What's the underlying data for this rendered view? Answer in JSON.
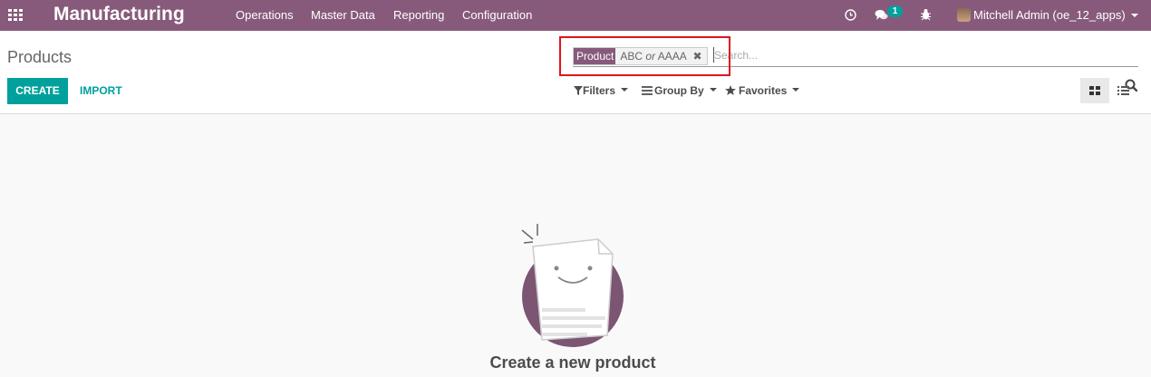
{
  "navbar": {
    "app_title": "Manufacturing",
    "menu": [
      "Operations",
      "Master Data",
      "Reporting",
      "Configuration"
    ],
    "messages_count": "1",
    "user": "Mitchell Admin (oe_12_apps)",
    "icons": [
      "apps-grid-icon",
      "clock-icon",
      "chat-icon",
      "bug-icon",
      "avatar",
      "caret-down-icon"
    ]
  },
  "page": {
    "title": "Products",
    "create_label": "CREATE",
    "import_label": "IMPORT"
  },
  "search": {
    "facet_category": "Product",
    "facet_value_a": "ABC",
    "facet_value_or": "or",
    "facet_value_b": "AAAA",
    "placeholder": "Search..."
  },
  "filters": {
    "filters_label": "Filters",
    "groupby_label": "Group By",
    "favorites_label": "Favorites"
  },
  "views": [
    "kanban",
    "list"
  ],
  "help": {
    "title": "Create a new product"
  },
  "colors": {
    "brand": "#875a7b",
    "accent": "#00a09d",
    "highlight": "#e0141b"
  }
}
